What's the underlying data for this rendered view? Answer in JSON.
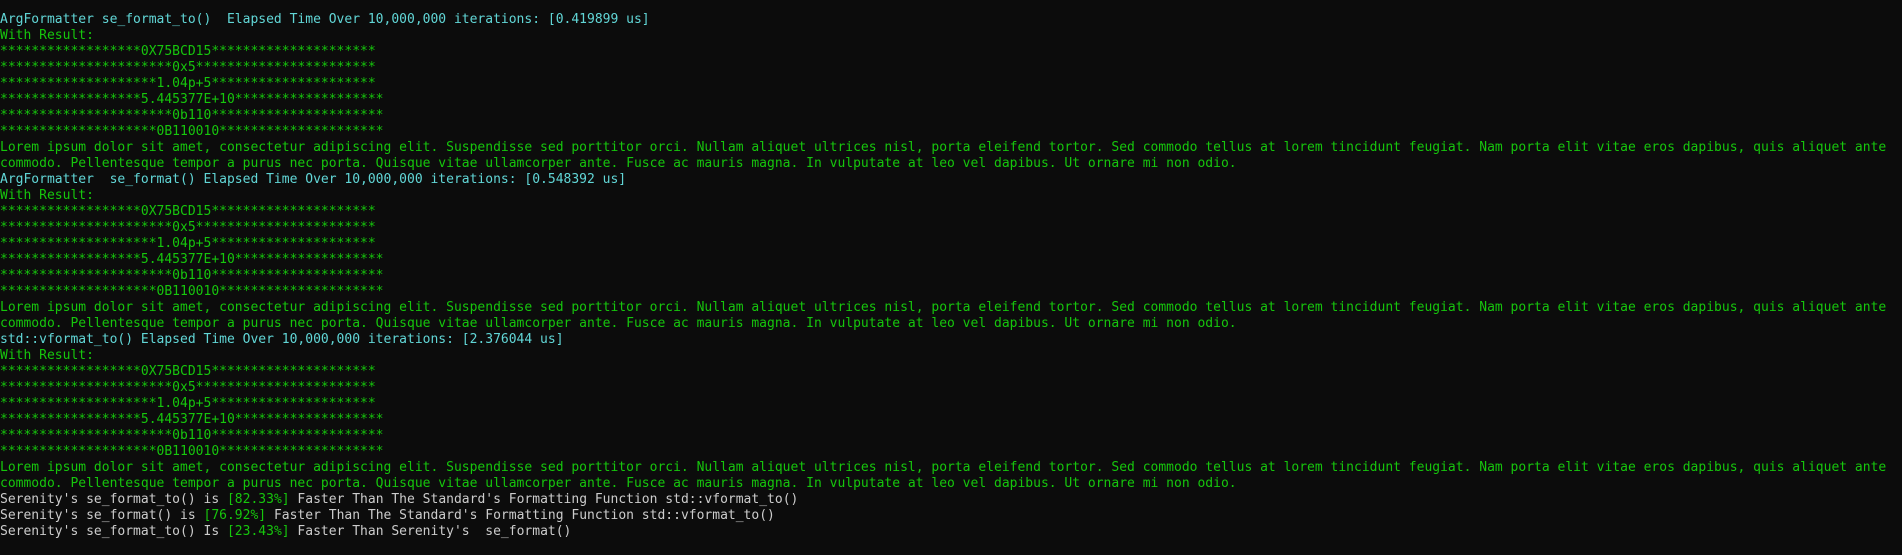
{
  "window": {
    "background": "#0c0c0c",
    "colors": {
      "header": "#61d6d6",
      "result": "#16c60c",
      "summary_text": "#cccccc",
      "summary_percent": "#16c60c"
    }
  },
  "blocks": [
    {
      "header": "ArgFormatter se_format_to()  Elapsed Time Over 10,000,000 iterations: [0.419899 us]",
      "with_result": "With Result:",
      "lines": [
        "******************0X75BCD15*********************",
        "**********************0x5***********************",
        "********************1.04p+5*********************",
        "******************5.445377E+10*******************",
        "**********************0b110**********************",
        "********************0B110010*********************"
      ],
      "lorem": "Lorem ipsum dolor sit amet, consectetur adipiscing elit. Suspendisse sed porttitor orci. Nullam aliquet ultrices nisl, porta eleifend tortor. Sed commodo tellus at lorem tincidunt feugiat. Nam porta elit vitae eros dapibus, quis aliquet ante commodo. Pellentesque tempor a purus nec porta. Quisque vitae ullamcorper ante. Fusce ac mauris magna. In vulputate at leo vel dapibus. Ut ornare mi non odio."
    },
    {
      "header": "ArgFormatter  se_format() Elapsed Time Over 10,000,000 iterations: [0.548392 us]",
      "with_result": "With Result:",
      "lines": [
        "******************0X75BCD15*********************",
        "**********************0x5***********************",
        "********************1.04p+5*********************",
        "******************5.445377E+10*******************",
        "**********************0b110**********************",
        "********************0B110010*********************"
      ],
      "lorem": "Lorem ipsum dolor sit amet, consectetur adipiscing elit. Suspendisse sed porttitor orci. Nullam aliquet ultrices nisl, porta eleifend tortor. Sed commodo tellus at lorem tincidunt feugiat. Nam porta elit vitae eros dapibus, quis aliquet ante commodo. Pellentesque tempor a purus nec porta. Quisque vitae ullamcorper ante. Fusce ac mauris magna. In vulputate at leo vel dapibus. Ut ornare mi non odio."
    },
    {
      "header": "std::vformat_to() Elapsed Time Over 10,000,000 iterations: [2.376044 us]",
      "with_result": "With Result:",
      "lines": [
        "******************0X75BCD15*********************",
        "**********************0x5***********************",
        "********************1.04p+5*********************",
        "******************5.445377E+10*******************",
        "**********************0b110**********************",
        "********************0B110010*********************"
      ],
      "lorem": "Lorem ipsum dolor sit amet, consectetur adipiscing elit. Suspendisse sed porttitor orci. Nullam aliquet ultrices nisl, porta eleifend tortor. Sed commodo tellus at lorem tincidunt feugiat. Nam porta elit vitae eros dapibus, quis aliquet ante commodo. Pellentesque tempor a purus nec porta. Quisque vitae ullamcorper ante. Fusce ac mauris magna. In vulputate at leo vel dapibus. Ut ornare mi non odio."
    }
  ],
  "summary": [
    {
      "prefix": "Serenity's se_format_to() is ",
      "percent": "[82.33%]",
      "suffix": " Faster Than The Standard's Formatting Function std::vformat_to()"
    },
    {
      "prefix": "Serenity's se_format() is ",
      "percent": "[76.92%]",
      "suffix": " Faster Than The Standard's Formatting Function std::vformat_to()"
    },
    {
      "prefix": "Serenity's se_format_to() Is ",
      "percent": "[23.43%]",
      "suffix": " Faster Than Serenity's  se_format()"
    }
  ]
}
